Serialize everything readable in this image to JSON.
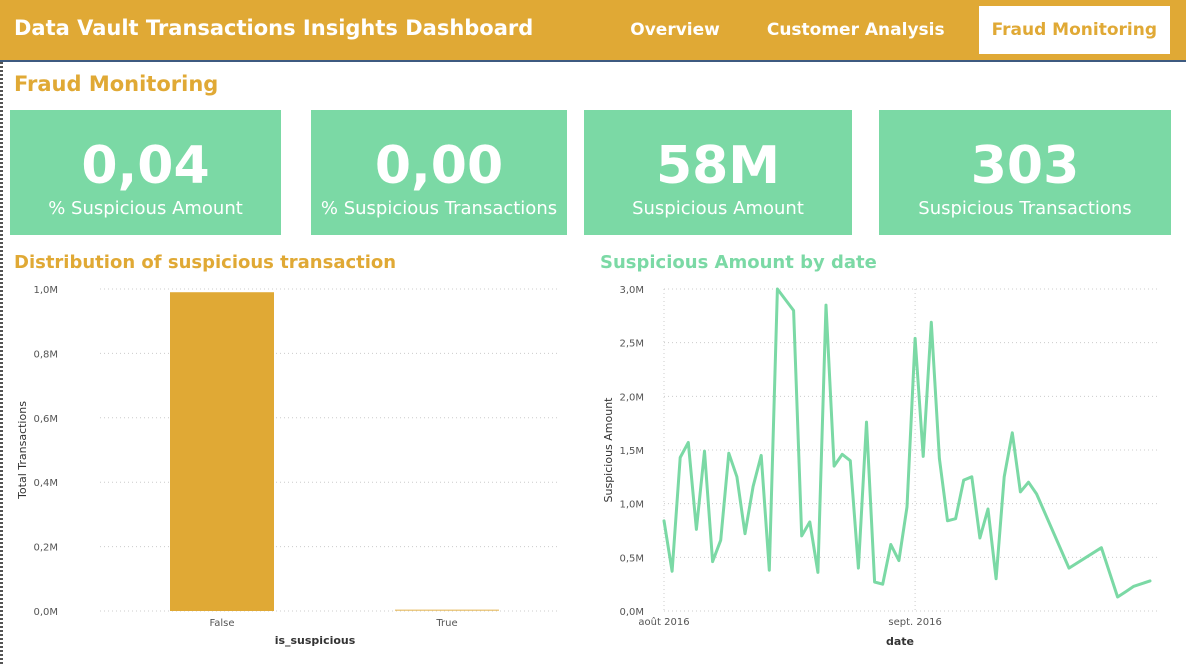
{
  "header": {
    "title": "Data Vault Transactions Insights Dashboard",
    "tabs": [
      {
        "label": "Overview",
        "active": false
      },
      {
        "label": "Customer Analysis",
        "active": false
      },
      {
        "label": "Fraud Monitoring",
        "active": true
      }
    ]
  },
  "page": {
    "title": "Fraud Monitoring"
  },
  "kpis": [
    {
      "value": "0,04",
      "label": "% Suspicious Amount"
    },
    {
      "value": "0,00",
      "label": "% Suspicious Transactions"
    },
    {
      "value": "58M",
      "label": "Suspicious Amount"
    },
    {
      "value": "303",
      "label": "Suspicious Transactions"
    }
  ],
  "colors": {
    "brand": "#e0a935",
    "kpi_bg": "#7bd9a5",
    "line": "#7bd9a5",
    "text": "#ffffff"
  },
  "chart_data": [
    {
      "type": "bar",
      "title": "Distribution of suspicious transaction",
      "xlabel": "is_suspicious",
      "ylabel": "Total Transactions",
      "categories": [
        "False",
        "True"
      ],
      "values": [
        990000,
        4000
      ],
      "ylim": [
        0,
        1000000
      ],
      "yticks": [
        0,
        200000,
        400000,
        600000,
        800000,
        1000000
      ],
      "ytick_labels": [
        "0,0M",
        "0,2M",
        "0,4M",
        "0,6M",
        "0,8M",
        "1,0M"
      ],
      "grid": true,
      "color": "#e0a935"
    },
    {
      "type": "line",
      "title": "Suspicious Amount by date",
      "xlabel": "date",
      "ylabel": "Suspicious Amount",
      "xlim": [
        "2016-08-01",
        "2016-09-30"
      ],
      "xticks": [
        "2016-08-01",
        "2016-09-01"
      ],
      "xtick_labels": [
        "août 2016",
        "sept. 2016"
      ],
      "ylim": [
        0,
        3000000
      ],
      "yticks": [
        0,
        500000,
        1000000,
        1500000,
        2000000,
        2500000,
        3000000
      ],
      "ytick_labels": [
        "0,0M",
        "0,5M",
        "1,0M",
        "1,5M",
        "2,0M",
        "2,5M",
        "3,0M"
      ],
      "grid": true,
      "color": "#7bd9a5",
      "x": [
        "2016-08-01",
        "2016-08-02",
        "2016-08-03",
        "2016-08-04",
        "2016-08-05",
        "2016-08-06",
        "2016-08-07",
        "2016-08-08",
        "2016-08-09",
        "2016-08-10",
        "2016-08-11",
        "2016-08-12",
        "2016-08-13",
        "2016-08-14",
        "2016-08-15",
        "2016-08-17",
        "2016-08-18",
        "2016-08-19",
        "2016-08-20",
        "2016-08-21",
        "2016-08-22",
        "2016-08-23",
        "2016-08-24",
        "2016-08-25",
        "2016-08-26",
        "2016-08-27",
        "2016-08-28",
        "2016-08-29",
        "2016-08-30",
        "2016-08-31",
        "2016-09-01",
        "2016-09-02",
        "2016-09-03",
        "2016-09-04",
        "2016-09-05",
        "2016-09-06",
        "2016-09-07",
        "2016-09-08",
        "2016-09-09",
        "2016-09-10",
        "2016-09-11",
        "2016-09-12",
        "2016-09-13",
        "2016-09-14",
        "2016-09-15",
        "2016-09-16",
        "2016-09-20",
        "2016-09-24",
        "2016-09-26",
        "2016-09-27",
        "2016-09-28",
        "2016-09-30"
      ],
      "values": [
        840000,
        370000,
        1430000,
        1570000,
        760000,
        1490000,
        460000,
        660000,
        1470000,
        1250000,
        720000,
        1160000,
        1450000,
        380000,
        3000000,
        2800000,
        700000,
        830000,
        360000,
        2850000,
        1350000,
        1460000,
        1400000,
        400000,
        1760000,
        270000,
        250000,
        620000,
        470000,
        970000,
        2540000,
        1440000,
        2690000,
        1420000,
        840000,
        860000,
        1220000,
        1250000,
        680000,
        950000,
        300000,
        1250000,
        1660000,
        1110000,
        1200000,
        1090000,
        400000,
        590000,
        130000,
        180000,
        230000,
        280000
      ]
    }
  ]
}
